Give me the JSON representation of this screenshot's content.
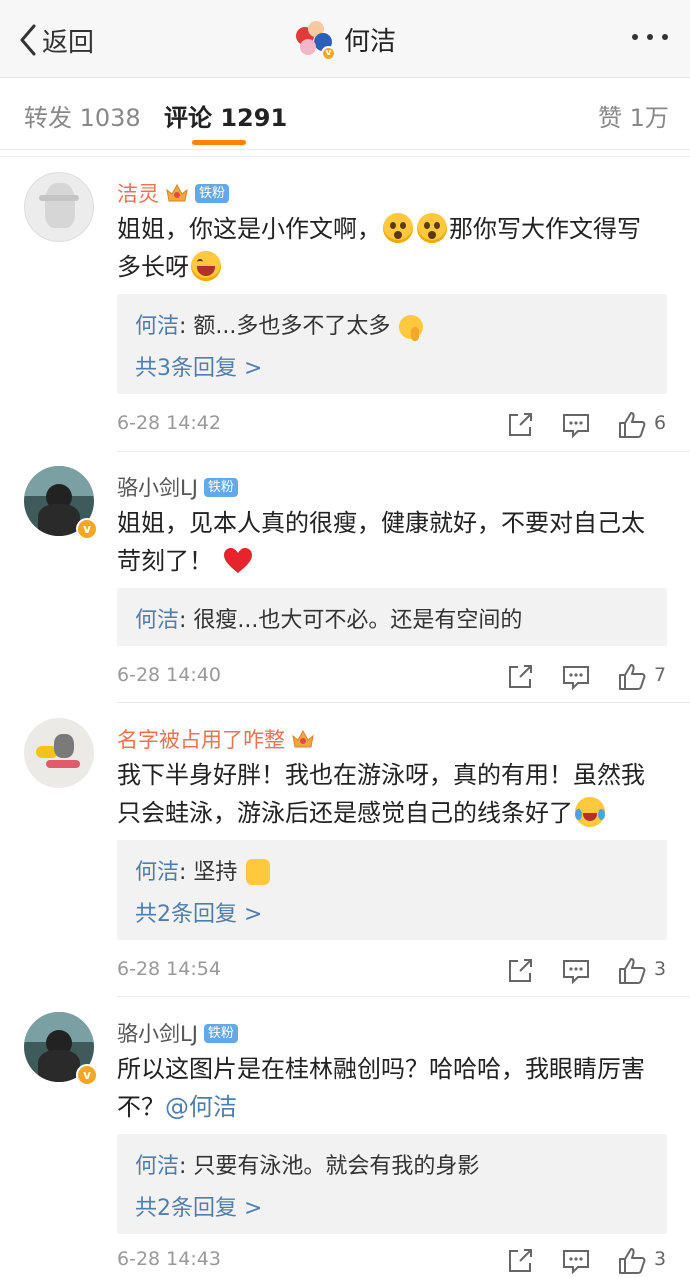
{
  "header": {
    "back_label": "返回",
    "title": "何洁"
  },
  "tabs": [
    {
      "label": "转发 1038"
    },
    {
      "label": "评论 1291"
    },
    {
      "label": "赞 1万"
    }
  ],
  "comments": [
    {
      "username": "洁灵",
      "fan_badge": "铁粉",
      "text_parts": [
        "姐姐，你这是小作文啊，",
        "那你写大作文得写多长呀"
      ],
      "reply": {
        "author": "何洁",
        "text": ": 额...多也多不了太多"
      },
      "more_replies": "共3条回复 >",
      "time": "6-28 14:42",
      "likes": "6"
    },
    {
      "username": "骆小剑LJ",
      "fan_badge": "铁粉",
      "text_parts": [
        "姐姐，见本人真的很瘦，健康就好，不要对自己太苛刻了！"
      ],
      "reply": {
        "author": "何洁",
        "text": ": 很瘦...也大可不必。还是有空间的"
      },
      "time": "6-28 14:40",
      "likes": "7"
    },
    {
      "username": "名字被占用了咋整",
      "text_parts": [
        "我下半身好胖！我也在游泳呀，真的有用！虽然我只会蛙泳，游泳后还是感觉自己的线条好了"
      ],
      "reply": {
        "author": "何洁",
        "text": ": 坚持"
      },
      "more_replies": "共2条回复 >",
      "time": "6-28 14:54",
      "likes": "3"
    },
    {
      "username": "骆小剑LJ",
      "fan_badge": "铁粉",
      "text_parts": [
        "所以这图片是在桂林融创吗？哈哈哈，我眼睛厉害不？",
        "@何洁"
      ],
      "reply": {
        "author": "何洁",
        "text": ": 只要有泳池。就会有我的身影"
      },
      "more_replies": "共2条回复 >",
      "time": "6-28 14:43",
      "likes": "3"
    }
  ]
}
